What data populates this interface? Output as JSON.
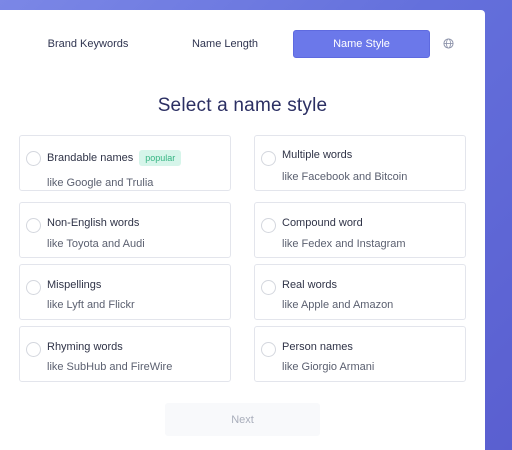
{
  "tabs": [
    {
      "label": "Brand Keywords",
      "active": false
    },
    {
      "label": "Name Length",
      "active": false
    },
    {
      "label": "Name Style",
      "active": true
    }
  ],
  "icons": {
    "language": "globe-icon",
    "option_radio": "radio-circle-icon"
  },
  "colors": {
    "accent": "#6b78ea",
    "badge_bg": "#d6f5ea",
    "badge_text": "#37b584",
    "heading": "#2b2f63"
  },
  "heading": "Select a name style",
  "options": [
    {
      "title": "Brandable names",
      "badge": "popular",
      "example": "like Google and Trulia"
    },
    {
      "title": "Multiple words",
      "badge": "",
      "example": "like Facebook and Bitcoin"
    },
    {
      "title": "Non-English words",
      "badge": "",
      "example": "like Toyota and Audi"
    },
    {
      "title": "Compound word",
      "badge": "",
      "example": "like Fedex and Instagram"
    },
    {
      "title": "Mispellings",
      "badge": "",
      "example": "like Lyft and Flickr"
    },
    {
      "title": "Real words",
      "badge": "",
      "example": "like Apple and Amazon"
    },
    {
      "title": "Rhyming words",
      "badge": "",
      "example": "like SubHub and FireWire"
    },
    {
      "title": "Person names",
      "badge": "",
      "example": "like Giorgio Armani"
    }
  ],
  "next_label": "Next"
}
